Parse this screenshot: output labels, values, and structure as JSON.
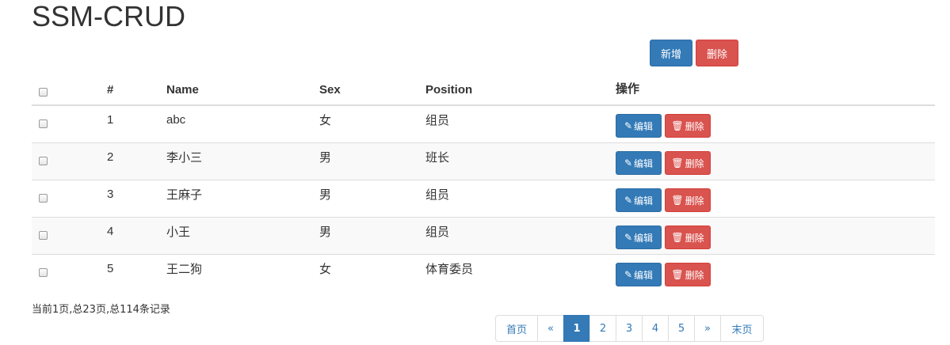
{
  "header": {
    "title": "SSM-CRUD"
  },
  "toolbar": {
    "add_label": "新增",
    "delete_label": "删除"
  },
  "table": {
    "columns": [
      "#",
      "Name",
      "Sex",
      "Position",
      "操作"
    ],
    "rows": [
      {
        "id": "1",
        "name": "abc",
        "sex": "女",
        "position": "组员"
      },
      {
        "id": "2",
        "name": "李小三",
        "sex": "男",
        "position": "班长"
      },
      {
        "id": "3",
        "name": "王麻子",
        "sex": "男",
        "position": "组员"
      },
      {
        "id": "4",
        "name": "小王",
        "sex": "男",
        "position": "组员"
      },
      {
        "id": "5",
        "name": "王二狗",
        "sex": "女",
        "position": "体育委员"
      }
    ],
    "edit_label": "编辑",
    "delete_label": "删除",
    "edit_icon": "pencil-icon",
    "delete_icon": "trash-icon"
  },
  "page_info": "当前1页,总23页,总114条记录",
  "pagination": {
    "first": "首页",
    "prev": "«",
    "pages": [
      "1",
      "2",
      "3",
      "4",
      "5"
    ],
    "active_page": "1",
    "next": "»",
    "last": "末页"
  },
  "colors": {
    "primary": "#337ab7",
    "danger": "#d9534f",
    "stripe": "#f9f9f9"
  }
}
